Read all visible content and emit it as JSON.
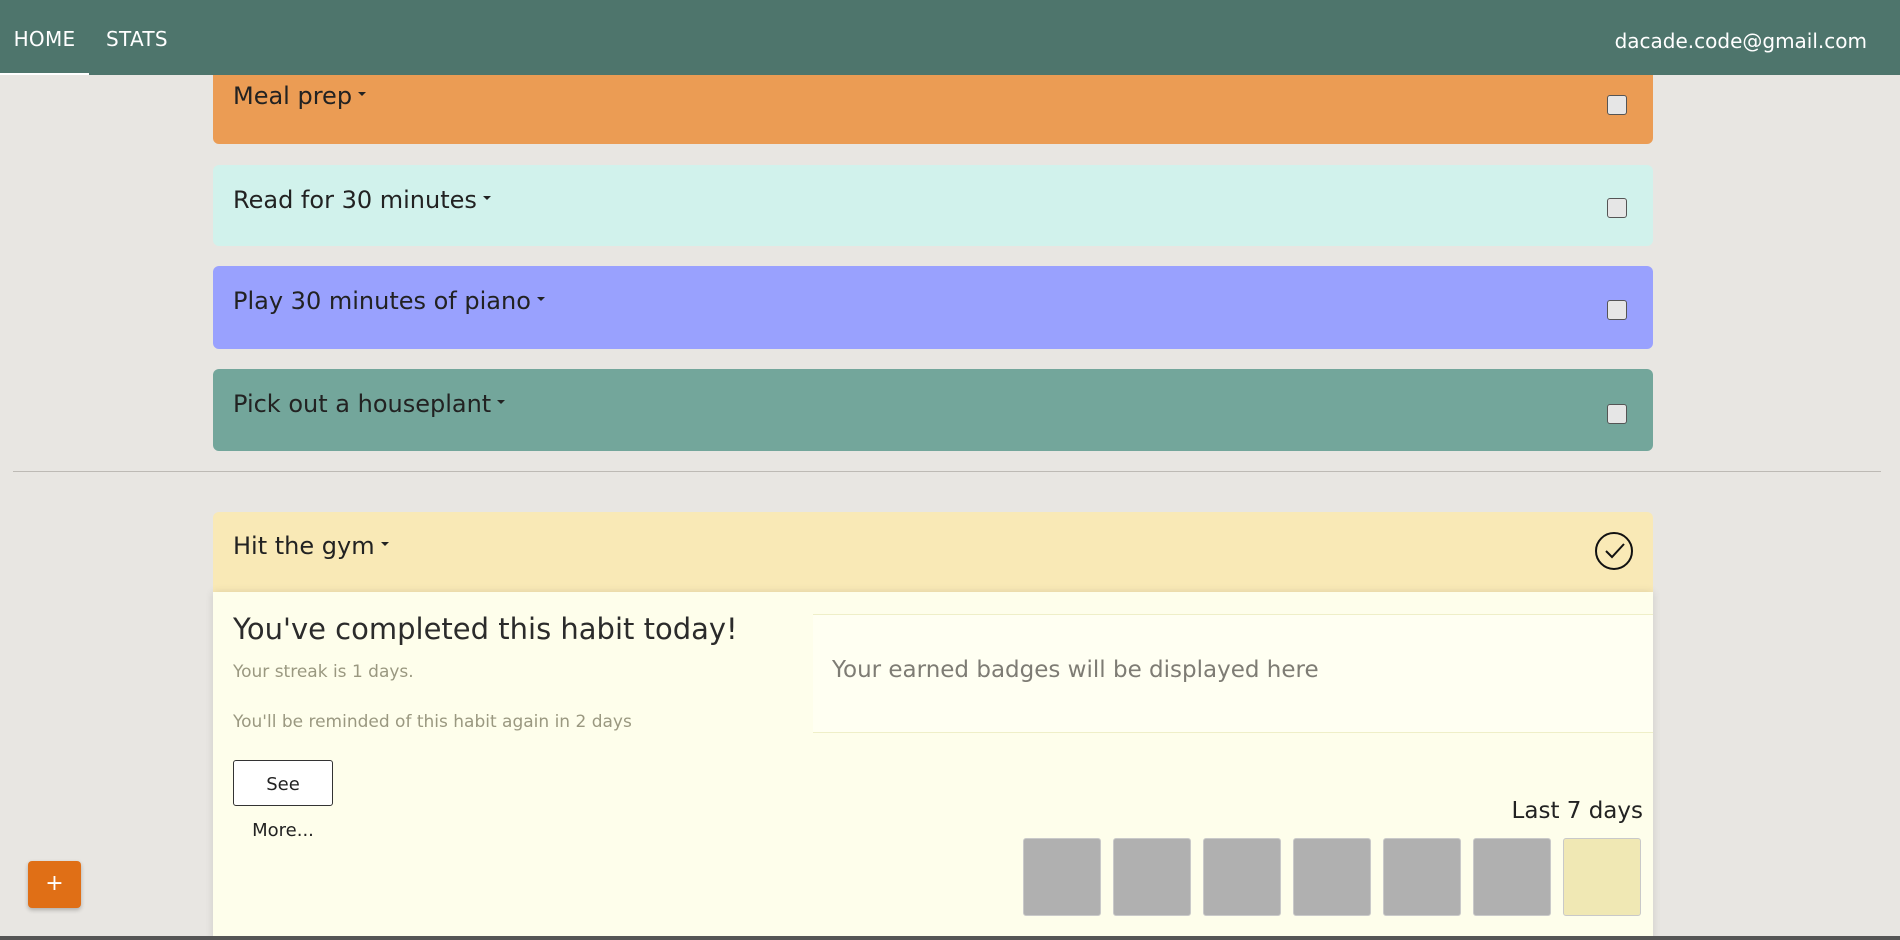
{
  "nav": {
    "tabs": [
      {
        "label": "HOME",
        "active": true
      },
      {
        "label": "STATS",
        "active": false
      }
    ],
    "user_email": "dacade.code@gmail.com"
  },
  "habits": [
    {
      "title": "Meal prep",
      "color": "#eb9c54",
      "checked": false
    },
    {
      "title": "Read for 30 minutes",
      "color": "#d1f2ec",
      "checked": false
    },
    {
      "title": "Play 30 minutes of piano",
      "color": "#99a1fe",
      "checked": false
    },
    {
      "title": "Pick out a houseplant",
      "color": "#73a69b",
      "checked": false
    }
  ],
  "completed_habit": {
    "title": "Hit the gym",
    "color": "#f9e9b6",
    "heading": "You've completed this habit today!",
    "streak_text": "Your streak is 1 days.",
    "reminder_text": "You'll be reminded of this habit again in 2 days",
    "see_more_label": "See More...",
    "badges_text": "Your earned badges will be displayed here",
    "last_days_label": "Last 7 days",
    "last_7_days": [
      {
        "done": false,
        "color": "#b0b0b0"
      },
      {
        "done": false,
        "color": "#b0b0b0"
      },
      {
        "done": false,
        "color": "#b0b0b0"
      },
      {
        "done": false,
        "color": "#b0b0b0"
      },
      {
        "done": false,
        "color": "#b0b0b0"
      },
      {
        "done": false,
        "color": "#b0b0b0"
      },
      {
        "done": true,
        "color": "#f0e8b4"
      }
    ]
  },
  "fab": {
    "label": "+"
  },
  "colors": {
    "navbar": "#4e756c",
    "background": "#e8e6e2",
    "fab": "#e06f16"
  }
}
